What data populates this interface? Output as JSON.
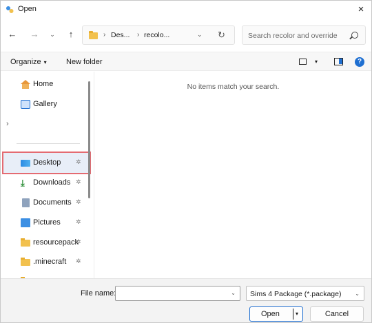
{
  "window": {
    "title": "Open",
    "close_glyph": "×"
  },
  "nav": {
    "back_glyph": "←",
    "forward_glyph": "→",
    "recent_glyph": "⌄",
    "up_glyph": "↑"
  },
  "address": {
    "crumbs": [
      "Des...",
      "recolo..."
    ],
    "separator": "›",
    "dropdown_glyph": "⌄",
    "refresh_glyph": "↻"
  },
  "search": {
    "placeholder": "Search recolor and override"
  },
  "command_bar": {
    "organize_label": "Organize",
    "caret": "▾",
    "new_folder_label": "New folder",
    "help_glyph": "?"
  },
  "sidebar": {
    "expand_glyph": "›",
    "pin_glyph": "✲",
    "items": [
      {
        "label": "Home",
        "icon": "home-icon"
      },
      {
        "label": "Gallery",
        "icon": "gallery-icon"
      },
      {
        "label": "Desktop",
        "icon": "desktop-icon",
        "pinned": true,
        "selected": true
      },
      {
        "label": "Downloads",
        "icon": "downloads-icon",
        "pinned": true
      },
      {
        "label": "Documents",
        "icon": "documents-icon",
        "pinned": true
      },
      {
        "label": "Pictures",
        "icon": "pictures-icon",
        "pinned": true
      },
      {
        "label": "resourcepack",
        "icon": "folder-icon",
        "pinned": true
      },
      {
        "label": ".minecraft",
        "icon": "folder-icon",
        "pinned": true
      }
    ]
  },
  "content": {
    "empty_message": "No items match your search."
  },
  "footer": {
    "file_name_label": "File name:",
    "file_name_value": "",
    "file_type_value": "Sims 4 Package (*.package)",
    "open_label": "Open",
    "cancel_label": "Cancel",
    "caret": "⌄",
    "split_caret": "▾"
  },
  "colors": {
    "accent": "#1f6fd1",
    "highlight_border": "#e46b72",
    "folder": "#f2c14e"
  }
}
